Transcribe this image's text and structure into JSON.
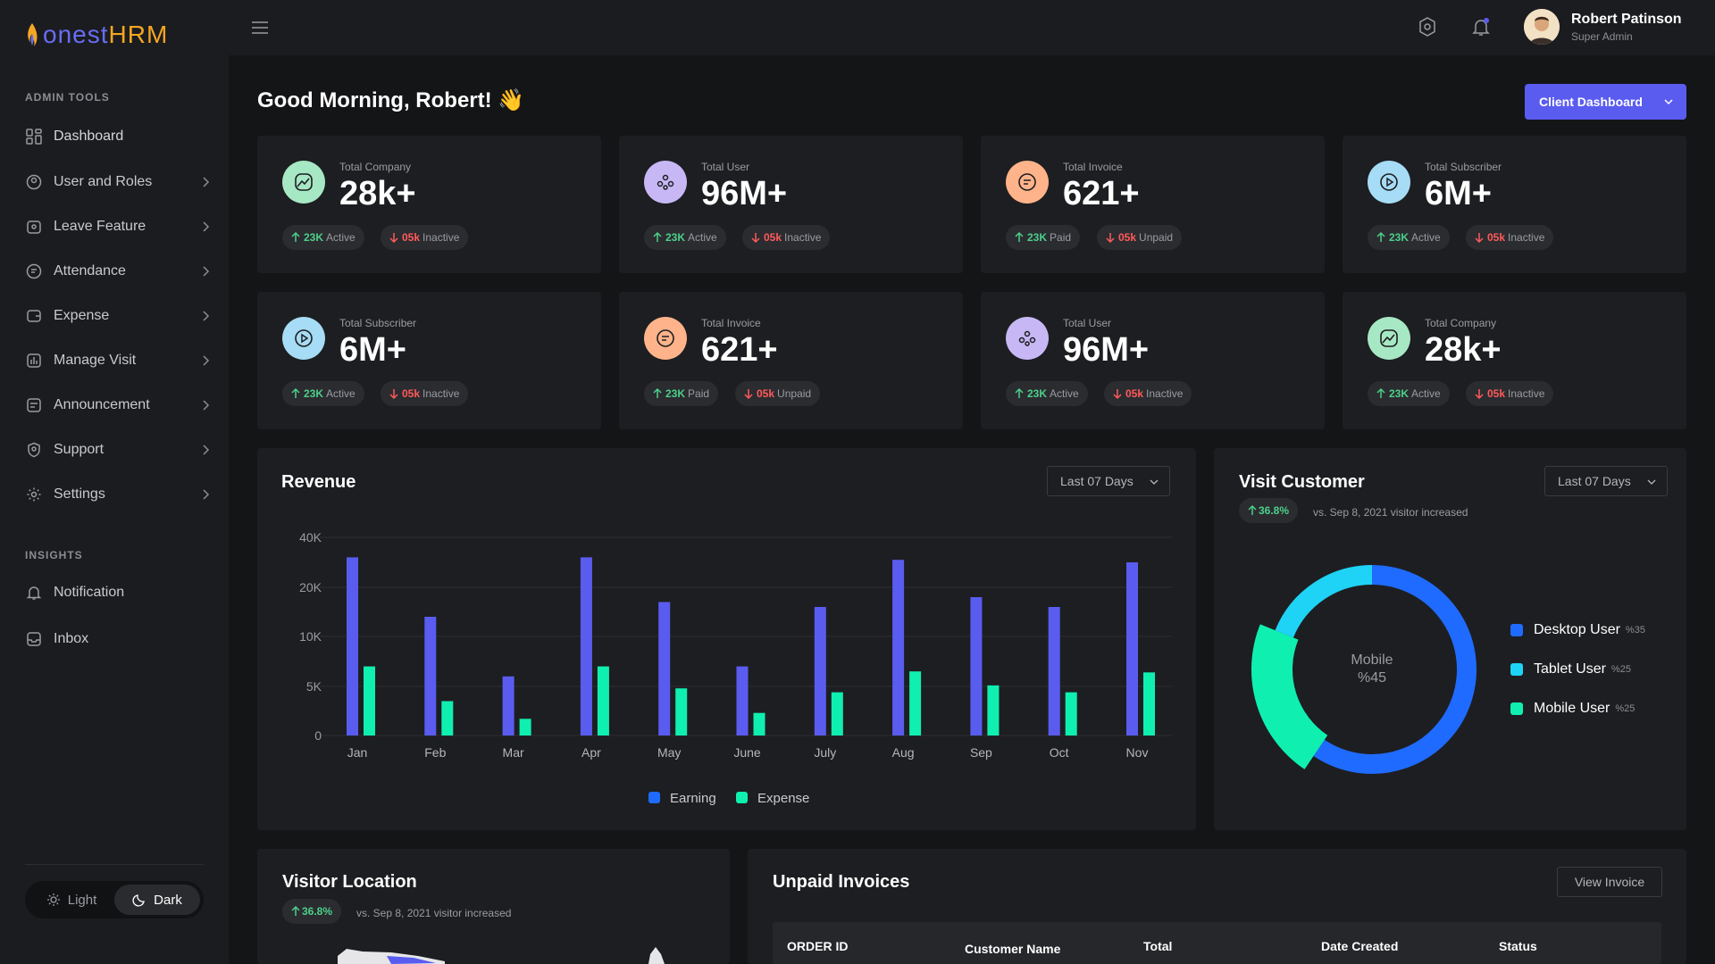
{
  "brand": {
    "name_part1": "onest",
    "name_part2": "HRM"
  },
  "sidebar": {
    "admin_title": "ADMIN TOOLS",
    "items": [
      {
        "label": "Dashboard",
        "icon": "dashboard-icon"
      },
      {
        "label": "User and Roles",
        "icon": "user-roles-icon"
      },
      {
        "label": "Leave Feature",
        "icon": "leave-icon"
      },
      {
        "label": "Attendance",
        "icon": "attendance-icon"
      },
      {
        "label": "Expense",
        "icon": "expense-icon"
      },
      {
        "label": "Manage Visit",
        "icon": "visit-icon"
      },
      {
        "label": "Announcement",
        "icon": "announcement-icon"
      },
      {
        "label": "Support",
        "icon": "support-icon"
      },
      {
        "label": "Settings",
        "icon": "settings-icon"
      }
    ],
    "insights_title": "INSIGHTS",
    "insights": [
      {
        "label": "Notification",
        "icon": "bell-icon"
      },
      {
        "label": "Inbox",
        "icon": "inbox-icon"
      }
    ],
    "theme": {
      "light": "Light",
      "dark": "Dark",
      "selected": "Dark"
    }
  },
  "user": {
    "name": "Robert Patinson",
    "role": "Super Admin"
  },
  "greeting": "Good Morning, Robert! 👋",
  "client_dashboard_label": "Client Dashboard",
  "stats": [
    {
      "label": "Total Company",
      "value": "28k+",
      "up": "23K",
      "up_text": "Active",
      "down": "05k",
      "down_text": "Inactive",
      "color": "#a7e8c4"
    },
    {
      "label": "Total User",
      "value": "96M+",
      "up": "23K",
      "up_text": "Active",
      "down": "05k",
      "down_text": "Inactive",
      "color": "#c7b8f5"
    },
    {
      "label": "Total Invoice",
      "value": "621+",
      "up": "23K",
      "up_text": "Paid",
      "down": "05k",
      "down_text": "Unpaid",
      "color": "#ffb38a"
    },
    {
      "label": "Total Subscriber",
      "value": "6M+",
      "up": "23K",
      "up_text": "Active",
      "down": "05k",
      "down_text": "Inactive",
      "color": "#a6dcf5"
    },
    {
      "label": "Total Subscriber",
      "value": "6M+",
      "up": "23K",
      "up_text": "Active",
      "down": "05k",
      "down_text": "Inactive",
      "color": "#a6dcf5"
    },
    {
      "label": "Total Invoice",
      "value": "621+",
      "up": "23K",
      "up_text": "Paid",
      "down": "05k",
      "down_text": "Unpaid",
      "color": "#ffb38a"
    },
    {
      "label": "Total User",
      "value": "96M+",
      "up": "23K",
      "up_text": "Active",
      "down": "05k",
      "down_text": "Inactive",
      "color": "#c7b8f5"
    },
    {
      "label": "Total Company",
      "value": "28k+",
      "up": "23K",
      "up_text": "Active",
      "down": "05k",
      "down_text": "Inactive",
      "color": "#a7e8c4"
    }
  ],
  "revenue": {
    "title": "Revenue",
    "range": "Last 07 Days"
  },
  "visit": {
    "title": "Visit Customer",
    "range": "Last 07 Days",
    "badge": "36.8%",
    "meta": "vs. Sep 8, 2021 visitor increased",
    "center_label": "Mobile",
    "center_value": "%45",
    "legend": [
      {
        "label": "Desktop User",
        "pct": "%35",
        "color": "#1f6bff"
      },
      {
        "label": "Tablet User",
        "pct": "%25",
        "color": "#1ed3f5"
      },
      {
        "label": "Mobile User",
        "pct": "%25",
        "color": "#0ff0b0"
      }
    ]
  },
  "location": {
    "title": "Visitor Location",
    "badge": "36.8%",
    "meta": "vs. Sep 8, 2021 visitor increased"
  },
  "invoices": {
    "title": "Unpaid Invoices",
    "view_label": "View Invoice",
    "columns": [
      "ORDER ID",
      "Customer Name",
      "Total",
      "Date Created",
      "Status"
    ]
  },
  "chart_data": [
    {
      "type": "bar",
      "categories": [
        "Jan",
        "Feb",
        "Mar",
        "Apr",
        "May",
        "June",
        "July",
        "Aug",
        "Sep",
        "Oct",
        "Nov"
      ],
      "series": [
        {
          "name": "Earning",
          "values": [
            32000,
            14000,
            6000,
            32000,
            17000,
            7000,
            16000,
            31000,
            18000,
            16000,
            30000
          ],
          "color": "#5a5cf0"
        },
        {
          "name": "Expense",
          "values": [
            7000,
            3500,
            1700,
            7000,
            4800,
            2300,
            4400,
            6500,
            5100,
            4400,
            6400
          ],
          "color": "#0ff0b0"
        }
      ],
      "y_ticks": [
        "0",
        "5K",
        "10K",
        "20K",
        "40K"
      ],
      "title": "Revenue",
      "legend_position": "bottom",
      "grid": true
    },
    {
      "type": "pie",
      "categories": [
        "Desktop User",
        "Tablet User",
        "Mobile User"
      ],
      "values": [
        35,
        25,
        25
      ],
      "title": "Visit Customer"
    }
  ]
}
